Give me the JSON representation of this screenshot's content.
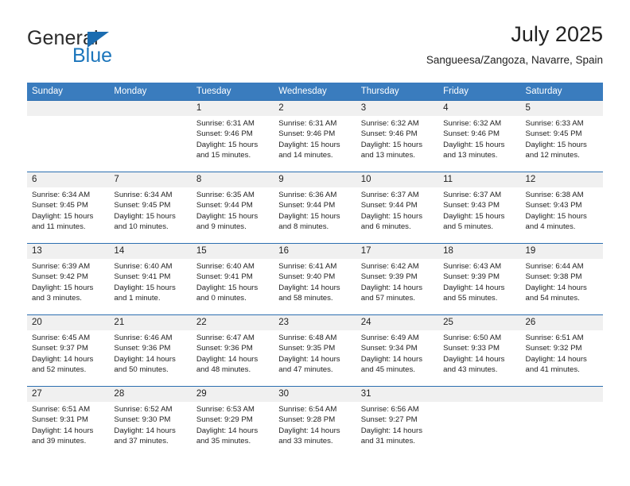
{
  "brand": {
    "name_part1": "General",
    "name_part2": "Blue",
    "accent_color": "#1b75bb",
    "logo_icon": "triangle-logo-icon"
  },
  "header": {
    "title": "July 2025",
    "subtitle": "Sangueesa/Zangoza, Navarre, Spain"
  },
  "calendar": {
    "weekday_headers": [
      "Sunday",
      "Monday",
      "Tuesday",
      "Wednesday",
      "Thursday",
      "Friday",
      "Saturday"
    ],
    "header_bg": "#3a7cbe",
    "divider_color": "#2c6fb0",
    "daynum_band_bg": "#f0f0f0",
    "weeks": [
      [
        {
          "day": "",
          "sunrise": "",
          "sunset": "",
          "daylight": "",
          "empty": true
        },
        {
          "day": "",
          "sunrise": "",
          "sunset": "",
          "daylight": "",
          "empty": true
        },
        {
          "day": "1",
          "sunrise": "Sunrise: 6:31 AM",
          "sunset": "Sunset: 9:46 PM",
          "daylight": "Daylight: 15 hours and 15 minutes."
        },
        {
          "day": "2",
          "sunrise": "Sunrise: 6:31 AM",
          "sunset": "Sunset: 9:46 PM",
          "daylight": "Daylight: 15 hours and 14 minutes."
        },
        {
          "day": "3",
          "sunrise": "Sunrise: 6:32 AM",
          "sunset": "Sunset: 9:46 PM",
          "daylight": "Daylight: 15 hours and 13 minutes."
        },
        {
          "day": "4",
          "sunrise": "Sunrise: 6:32 AM",
          "sunset": "Sunset: 9:46 PM",
          "daylight": "Daylight: 15 hours and 13 minutes."
        },
        {
          "day": "5",
          "sunrise": "Sunrise: 6:33 AM",
          "sunset": "Sunset: 9:45 PM",
          "daylight": "Daylight: 15 hours and 12 minutes."
        }
      ],
      [
        {
          "day": "6",
          "sunrise": "Sunrise: 6:34 AM",
          "sunset": "Sunset: 9:45 PM",
          "daylight": "Daylight: 15 hours and 11 minutes."
        },
        {
          "day": "7",
          "sunrise": "Sunrise: 6:34 AM",
          "sunset": "Sunset: 9:45 PM",
          "daylight": "Daylight: 15 hours and 10 minutes."
        },
        {
          "day": "8",
          "sunrise": "Sunrise: 6:35 AM",
          "sunset": "Sunset: 9:44 PM",
          "daylight": "Daylight: 15 hours and 9 minutes."
        },
        {
          "day": "9",
          "sunrise": "Sunrise: 6:36 AM",
          "sunset": "Sunset: 9:44 PM",
          "daylight": "Daylight: 15 hours and 8 minutes."
        },
        {
          "day": "10",
          "sunrise": "Sunrise: 6:37 AM",
          "sunset": "Sunset: 9:44 PM",
          "daylight": "Daylight: 15 hours and 6 minutes."
        },
        {
          "day": "11",
          "sunrise": "Sunrise: 6:37 AM",
          "sunset": "Sunset: 9:43 PM",
          "daylight": "Daylight: 15 hours and 5 minutes."
        },
        {
          "day": "12",
          "sunrise": "Sunrise: 6:38 AM",
          "sunset": "Sunset: 9:43 PM",
          "daylight": "Daylight: 15 hours and 4 minutes."
        }
      ],
      [
        {
          "day": "13",
          "sunrise": "Sunrise: 6:39 AM",
          "sunset": "Sunset: 9:42 PM",
          "daylight": "Daylight: 15 hours and 3 minutes."
        },
        {
          "day": "14",
          "sunrise": "Sunrise: 6:40 AM",
          "sunset": "Sunset: 9:41 PM",
          "daylight": "Daylight: 15 hours and 1 minute."
        },
        {
          "day": "15",
          "sunrise": "Sunrise: 6:40 AM",
          "sunset": "Sunset: 9:41 PM",
          "daylight": "Daylight: 15 hours and 0 minutes."
        },
        {
          "day": "16",
          "sunrise": "Sunrise: 6:41 AM",
          "sunset": "Sunset: 9:40 PM",
          "daylight": "Daylight: 14 hours and 58 minutes."
        },
        {
          "day": "17",
          "sunrise": "Sunrise: 6:42 AM",
          "sunset": "Sunset: 9:39 PM",
          "daylight": "Daylight: 14 hours and 57 minutes."
        },
        {
          "day": "18",
          "sunrise": "Sunrise: 6:43 AM",
          "sunset": "Sunset: 9:39 PM",
          "daylight": "Daylight: 14 hours and 55 minutes."
        },
        {
          "day": "19",
          "sunrise": "Sunrise: 6:44 AM",
          "sunset": "Sunset: 9:38 PM",
          "daylight": "Daylight: 14 hours and 54 minutes."
        }
      ],
      [
        {
          "day": "20",
          "sunrise": "Sunrise: 6:45 AM",
          "sunset": "Sunset: 9:37 PM",
          "daylight": "Daylight: 14 hours and 52 minutes."
        },
        {
          "day": "21",
          "sunrise": "Sunrise: 6:46 AM",
          "sunset": "Sunset: 9:36 PM",
          "daylight": "Daylight: 14 hours and 50 minutes."
        },
        {
          "day": "22",
          "sunrise": "Sunrise: 6:47 AM",
          "sunset": "Sunset: 9:36 PM",
          "daylight": "Daylight: 14 hours and 48 minutes."
        },
        {
          "day": "23",
          "sunrise": "Sunrise: 6:48 AM",
          "sunset": "Sunset: 9:35 PM",
          "daylight": "Daylight: 14 hours and 47 minutes."
        },
        {
          "day": "24",
          "sunrise": "Sunrise: 6:49 AM",
          "sunset": "Sunset: 9:34 PM",
          "daylight": "Daylight: 14 hours and 45 minutes."
        },
        {
          "day": "25",
          "sunrise": "Sunrise: 6:50 AM",
          "sunset": "Sunset: 9:33 PM",
          "daylight": "Daylight: 14 hours and 43 minutes."
        },
        {
          "day": "26",
          "sunrise": "Sunrise: 6:51 AM",
          "sunset": "Sunset: 9:32 PM",
          "daylight": "Daylight: 14 hours and 41 minutes."
        }
      ],
      [
        {
          "day": "27",
          "sunrise": "Sunrise: 6:51 AM",
          "sunset": "Sunset: 9:31 PM",
          "daylight": "Daylight: 14 hours and 39 minutes."
        },
        {
          "day": "28",
          "sunrise": "Sunrise: 6:52 AM",
          "sunset": "Sunset: 9:30 PM",
          "daylight": "Daylight: 14 hours and 37 minutes."
        },
        {
          "day": "29",
          "sunrise": "Sunrise: 6:53 AM",
          "sunset": "Sunset: 9:29 PM",
          "daylight": "Daylight: 14 hours and 35 minutes."
        },
        {
          "day": "30",
          "sunrise": "Sunrise: 6:54 AM",
          "sunset": "Sunset: 9:28 PM",
          "daylight": "Daylight: 14 hours and 33 minutes."
        },
        {
          "day": "31",
          "sunrise": "Sunrise: 6:56 AM",
          "sunset": "Sunset: 9:27 PM",
          "daylight": "Daylight: 14 hours and 31 minutes."
        },
        {
          "day": "",
          "sunrise": "",
          "sunset": "",
          "daylight": "",
          "empty": true
        },
        {
          "day": "",
          "sunrise": "",
          "sunset": "",
          "daylight": "",
          "empty": true
        }
      ]
    ]
  }
}
